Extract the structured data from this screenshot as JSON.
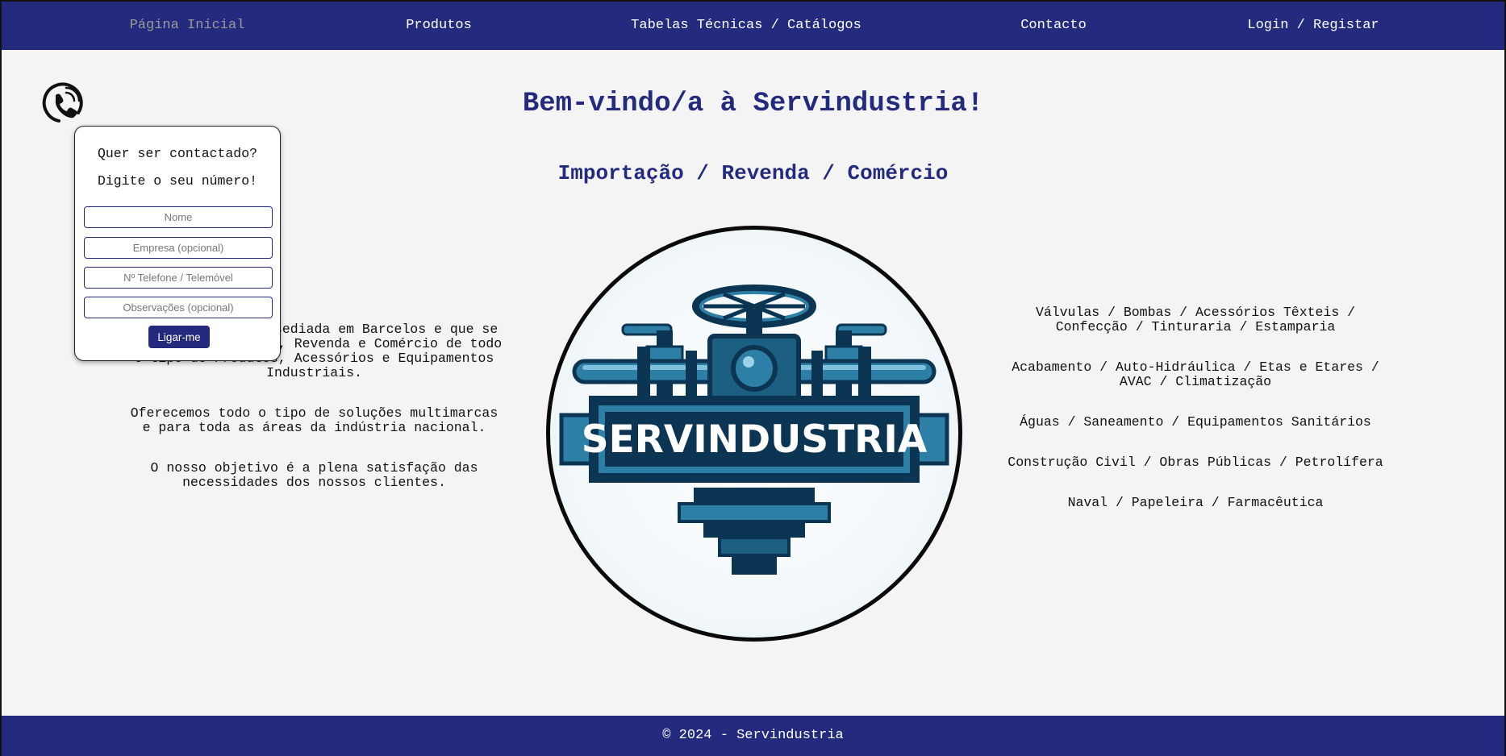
{
  "nav": {
    "items": [
      {
        "label": "Página Inicial",
        "active": true
      },
      {
        "label": "Produtos"
      },
      {
        "label": "Tabelas Técnicas / Catálogos"
      },
      {
        "label": "Contacto"
      },
      {
        "label": "Login / Registar"
      }
    ]
  },
  "main": {
    "title": "Bem-vindo/a à Servindustria!",
    "subtitle": "Importação / Revenda / Comércio",
    "left_paragraphs": [
      "Somos uma empresa sediada em Barcelos e que se dedica à Importação, Revenda e Comércio de todo o tipo de Produtos, Acessórios e Equipamentos Industriais.",
      "Oferecemos todo o tipo de soluções multimarcas e para toda as áreas da indústria nacional.",
      "O nosso objetivo é a plena satisfação das necessidades dos nossos clientes."
    ],
    "right_paragraphs": [
      "Válvulas / Bombas / Acessórios Têxteis / Confecção / Tinturaria / Estamparia",
      "Acabamento / Auto-Hidráulica / Etas e Etares / AVAC / Climatização",
      "Águas / Saneamento / Equipamentos Sanitários",
      "Construção Civil / Obras Públicas / Petrolífera",
      "Naval / Papeleira / Farmacêutica"
    ],
    "logo_text": "SERVINDUSTRIA"
  },
  "contact_popup": {
    "line1": "Quer ser contactado?",
    "line2": "Digite o seu número!",
    "name_placeholder": "Nome",
    "company_placeholder": "Empresa (opcional)",
    "phone_placeholder": "Nº Telefone / Telemóvel",
    "notes_placeholder": "Observações (opcional)",
    "button_label": "Ligar-me"
  },
  "icons": {
    "phone": "phone-icon"
  },
  "footer": {
    "text": "© 2024 - Servindustria"
  },
  "colors": {
    "primary": "#242b7e",
    "background": "#f4f4f4",
    "logo_dark": "#0b3552",
    "logo_blue": "#2d7fa6"
  }
}
